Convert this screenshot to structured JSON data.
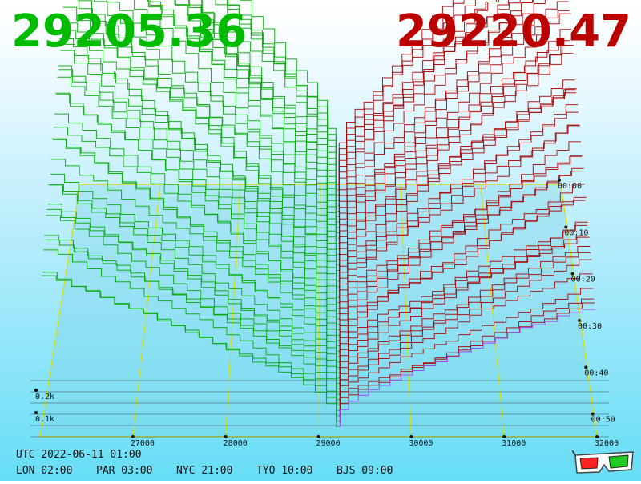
{
  "header": {
    "bid_price": "29205.36",
    "ask_price": "29220.47",
    "bid_color": "#00bb00",
    "ask_color": "#bb0000"
  },
  "footer": {
    "utc": "UTC 2022-06-11 01:00",
    "timezones": [
      {
        "label": "LON 02:00"
      },
      {
        "label": "PAR 03:00"
      },
      {
        "label": "NYC 21:00"
      },
      {
        "label": "TYO 10:00"
      },
      {
        "label": "BJS 09:00"
      }
    ],
    "glasses_icon": "3d-glasses-icon"
  },
  "chart_data": {
    "type": "area",
    "x": [
      27000,
      28000,
      29000,
      30000,
      31000,
      32000
    ],
    "x_tick_labels": [
      "27000",
      "28000",
      "29000",
      "30000",
      "31000",
      "32000"
    ],
    "z_tick_labels": [
      "0.1k",
      "0.2k"
    ],
    "time_tick_labels": [
      "00:00",
      "00:10",
      "00:20",
      "00:30",
      "00:40",
      "00:50"
    ],
    "xlim": [
      26000,
      32000
    ],
    "zlim": [
      0,
      0.6
    ],
    "bid_price": 29205.36,
    "ask_price": 29220.47,
    "colors": {
      "bid": "#00aa00",
      "ask": "#aa0000",
      "grid": "#dddd00",
      "baseline": "#aa33ff"
    }
  }
}
